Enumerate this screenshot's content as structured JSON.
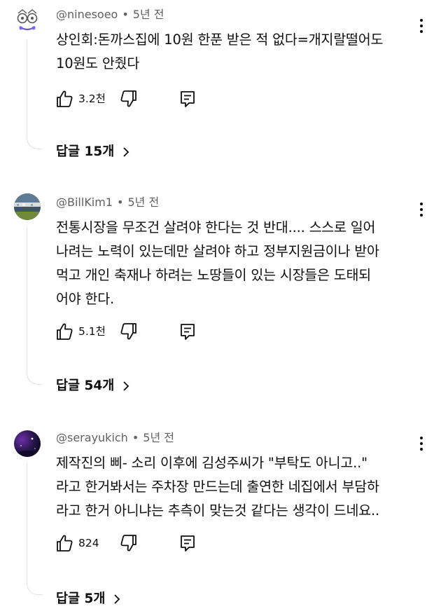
{
  "comments": [
    {
      "author": "@ninesoeo",
      "time": "5년 전",
      "text": "상인회:돈까스집에 10원 한푼 받은 적 없다=개지랄떨어도\n10원도 안줬다",
      "likes": "3.2천",
      "replies": "답글 15개",
      "avatar_icon": "doodle-face-avatar"
    },
    {
      "author": "@BillKim1",
      "time": "5년 전",
      "text": "전통시장을 무조건 살려야 한다는 것 반대.... 스스로 일어\n나려는 노력이 있는데만 살려야 하고 정부지원금이나 받아\n먹고 개인 축재나 하려는 노땅들이 있는 시장들은 도태되\n어야 한다.",
      "likes": "5.1천",
      "replies": "답글 54개",
      "avatar_icon": "stadium-photo-avatar"
    },
    {
      "author": "@serayukich",
      "time": "5년 전",
      "text": "제작진의 삐- 소리 이후에 김성주씨가 \"부탁도 아니고..\"\n라고 한거봐서는 주차장 만드는데 출연한 네집에서 부담하\n라고 한거 아니냐는 추측이 맞는것 같다는 생각이 드네요..",
      "likes": "824",
      "replies": "답글 5개",
      "avatar_icon": "night-sky-avatar"
    }
  ],
  "colors": {
    "text": "#0f0f0f",
    "meta": "#606060",
    "thread_line": "#e2e2e2",
    "background": "#ffffff"
  },
  "icons": {
    "like": "thumbs-up-icon",
    "dislike": "thumbs-down-icon",
    "reply": "reply-comment-icon",
    "more": "vertical-dots-icon",
    "chevron": "chevron-right-icon"
  }
}
